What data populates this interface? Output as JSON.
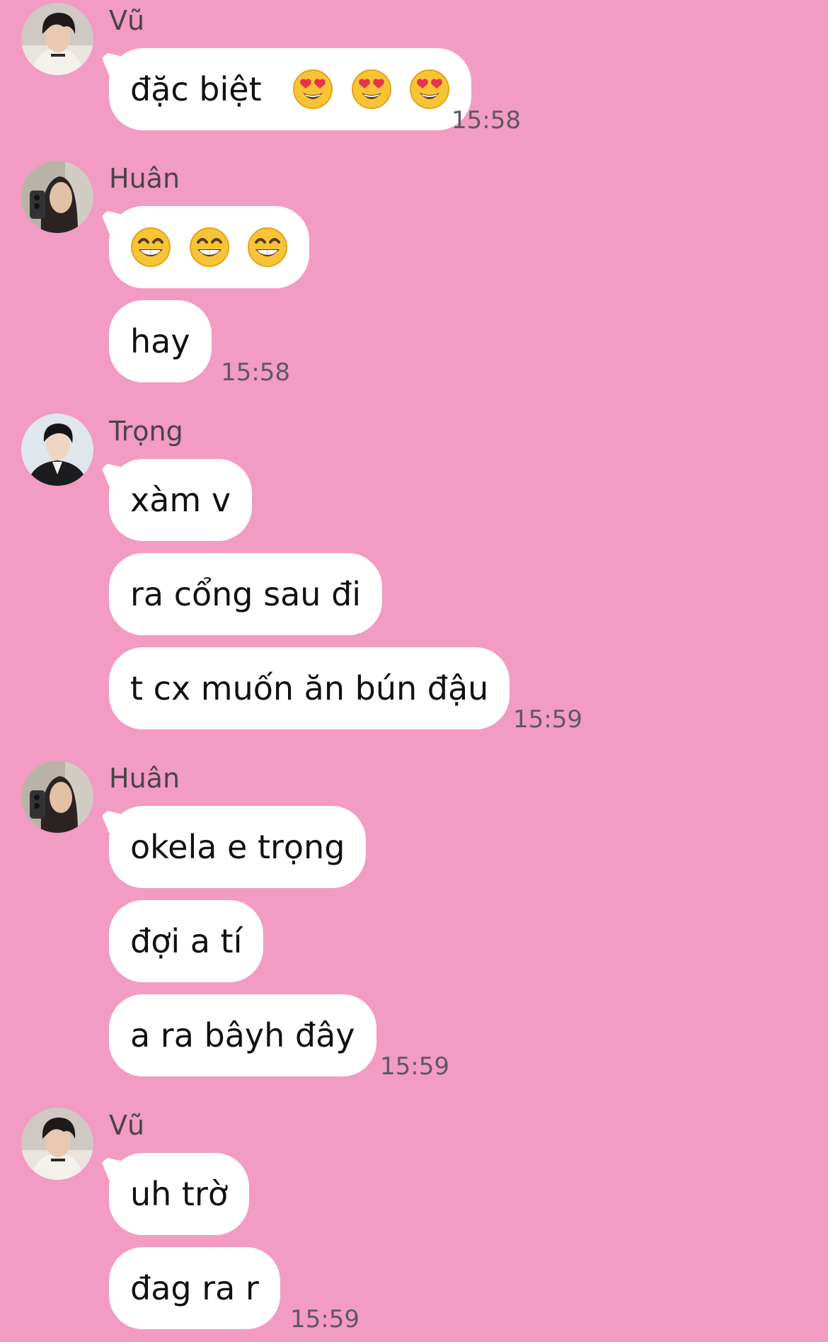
{
  "theme": {
    "background": "#f29bc3",
    "bubble": "#ffffff",
    "text": "#111111",
    "sender_color": "#4a4348",
    "time_color": "#5f5860"
  },
  "groups": [
    {
      "sender": "Vũ",
      "avatar": "avatar-vu",
      "messages": [
        {
          "text": "đặc biệt",
          "emojis": [
            "heart-eyes-emoji",
            "heart-eyes-emoji",
            "heart-eyes-emoji"
          ]
        }
      ],
      "time": "15:58"
    },
    {
      "sender": "Huân",
      "avatar": "avatar-huan",
      "messages": [
        {
          "text": "",
          "emojis": [
            "grinning-emoji",
            "grinning-emoji",
            "grinning-emoji"
          ]
        },
        {
          "text": "hay"
        }
      ],
      "time": "15:58"
    },
    {
      "sender": "Trọng",
      "avatar": "avatar-trong",
      "messages": [
        {
          "text": "xàm v"
        },
        {
          "text": "ra cổng sau đi"
        },
        {
          "text": "t cx muốn ăn bún đậu"
        }
      ],
      "time": "15:59"
    },
    {
      "sender": "Huân",
      "avatar": "avatar-huan",
      "messages": [
        {
          "text": "okela e trọng"
        },
        {
          "text": "đợi a tí"
        },
        {
          "text": "a ra bâyh đây"
        }
      ],
      "time": "15:59"
    },
    {
      "sender": "Vũ",
      "avatar": "avatar-vu",
      "messages": [
        {
          "text": "uh trờ"
        },
        {
          "text": "đag ra r"
        }
      ],
      "time": "15:59"
    }
  ]
}
